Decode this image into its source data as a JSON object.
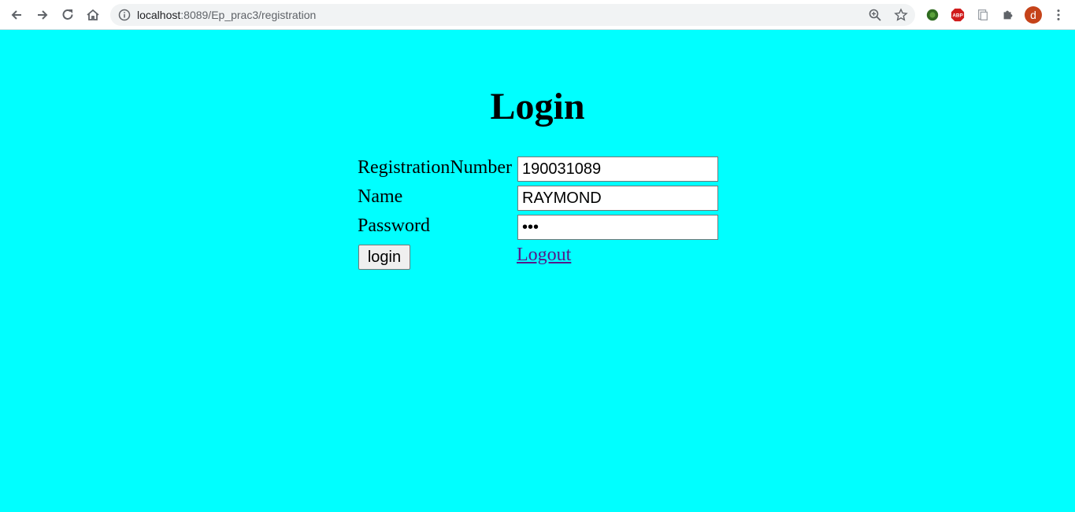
{
  "browser": {
    "url_host": "localhost",
    "url_path": ":8089/Ep_prac3/registration",
    "avatar_letter": "d",
    "icons": [
      "back-icon",
      "forward-icon",
      "reload-icon",
      "home-icon",
      "site-info-icon",
      "zoom-icon",
      "bookmark-star-icon",
      "extension-green-icon",
      "adblock-icon",
      "extension-page-icon",
      "extensions-puzzle-icon",
      "menu-kebab-icon"
    ]
  },
  "page": {
    "title": "Login",
    "background": "#00ffff"
  },
  "form": {
    "reg_label": "RegistrationNumber",
    "reg_value": "190031089",
    "name_label": "Name",
    "name_value": "RAYMOND",
    "password_label": "Password",
    "password_value": "abc",
    "login_label": "login",
    "logout_label": "Logout"
  }
}
